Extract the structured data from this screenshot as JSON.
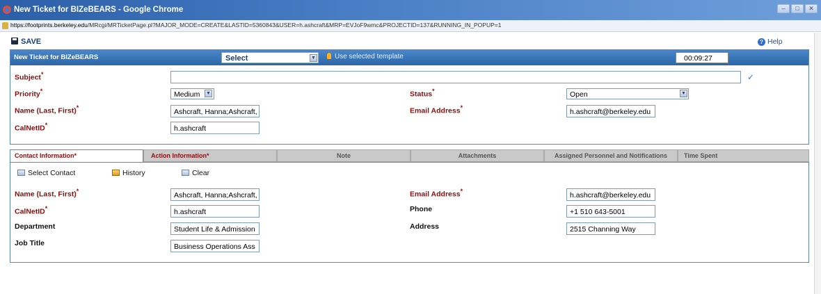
{
  "window": {
    "title": "New Ticket for BIZeBEARS - Google Chrome",
    "url_host": "https://footprints.berkeley.edu",
    "url_rest": "/MRcgi/MRTicketPage.pl?MAJOR_MODE=CREATE&LASTID=5360843&USER=h.ashcraft&MRP=EVJoF9wmc&PROJECTID=137&RUNNING_IN_POPUP=1",
    "min_glyph": "–",
    "max_glyph": "□",
    "close_glyph": "✕"
  },
  "toolbar": {
    "save_label": "SAVE",
    "help_label": "Help"
  },
  "header": {
    "title": "New Ticket for BIZeBEARS",
    "template_select": "Select",
    "use_template": "Use selected template",
    "timer": "00:09:27"
  },
  "ticket": {
    "subject_label": "Subject",
    "subject_value": "",
    "priority_label": "Priority",
    "priority_value": "Medium",
    "status_label": "Status",
    "status_value": "Open",
    "name_label": "Name (Last, First)",
    "name_value": "Ashcraft, Hanna;Ashcraft,",
    "email_label": "Email Address",
    "email_value": "h.ashcraft@berkeley.edu",
    "calnet_label": "CalNetID",
    "calnet_value": "h.ashcraft",
    "required_mark": "*"
  },
  "tabs": [
    {
      "label": "Contact Information*"
    },
    {
      "label": "Action Information*"
    },
    {
      "label": "Note"
    },
    {
      "label": "Attachments"
    },
    {
      "label": "Assigned Personnel and Notifications"
    },
    {
      "label": "Time Spent"
    }
  ],
  "contact_tools": {
    "select_contact": "Select Contact",
    "history": "History",
    "clear": "Clear"
  },
  "contact": {
    "name_label": "Name (Last, First)",
    "name_value": "Ashcraft, Hanna;Ashcraft,",
    "email_label": "Email Address",
    "email_value": "h.ashcraft@berkeley.edu",
    "calnet_label": "CalNetID",
    "calnet_value": "h.ashcraft",
    "phone_label": "Phone",
    "phone_value": "+1 510 643-5001",
    "department_label": "Department",
    "department_value": "Student Life & Admission",
    "address_label": "Address",
    "address_value": "2515 Channing Way",
    "jobtitle_label": "Job Title",
    "jobtitle_value": "Business Operations Ass"
  }
}
